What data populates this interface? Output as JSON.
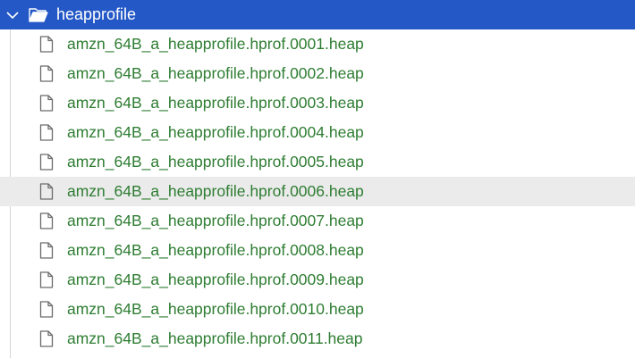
{
  "colors": {
    "selected_row_bg": "#2458c6",
    "selected_row_text": "#ffffff",
    "file_text": "#2e7d32",
    "hover_row_bg": "#ebebeb",
    "icon_stroke": "#6b6b6b"
  },
  "folder": {
    "name": "heapprofile",
    "expanded": true,
    "expand_icon": "chevron-down-icon",
    "icon": "folder-open-icon"
  },
  "files": [
    {
      "name": "amzn_64B_a_heapprofile.hprof.0001.heap",
      "icon": "file-icon"
    },
    {
      "name": "amzn_64B_a_heapprofile.hprof.0002.heap",
      "icon": "file-icon"
    },
    {
      "name": "amzn_64B_a_heapprofile.hprof.0003.heap",
      "icon": "file-icon"
    },
    {
      "name": "amzn_64B_a_heapprofile.hprof.0004.heap",
      "icon": "file-icon"
    },
    {
      "name": "amzn_64B_a_heapprofile.hprof.0005.heap",
      "icon": "file-icon"
    },
    {
      "name": "amzn_64B_a_heapprofile.hprof.0006.heap",
      "icon": "file-icon",
      "hovered": true
    },
    {
      "name": "amzn_64B_a_heapprofile.hprof.0007.heap",
      "icon": "file-icon"
    },
    {
      "name": "amzn_64B_a_heapprofile.hprof.0008.heap",
      "icon": "file-icon"
    },
    {
      "name": "amzn_64B_a_heapprofile.hprof.0009.heap",
      "icon": "file-icon"
    },
    {
      "name": "amzn_64B_a_heapprofile.hprof.0010.heap",
      "icon": "file-icon"
    },
    {
      "name": "amzn_64B_a_heapprofile.hprof.0011.heap",
      "icon": "file-icon"
    }
  ]
}
